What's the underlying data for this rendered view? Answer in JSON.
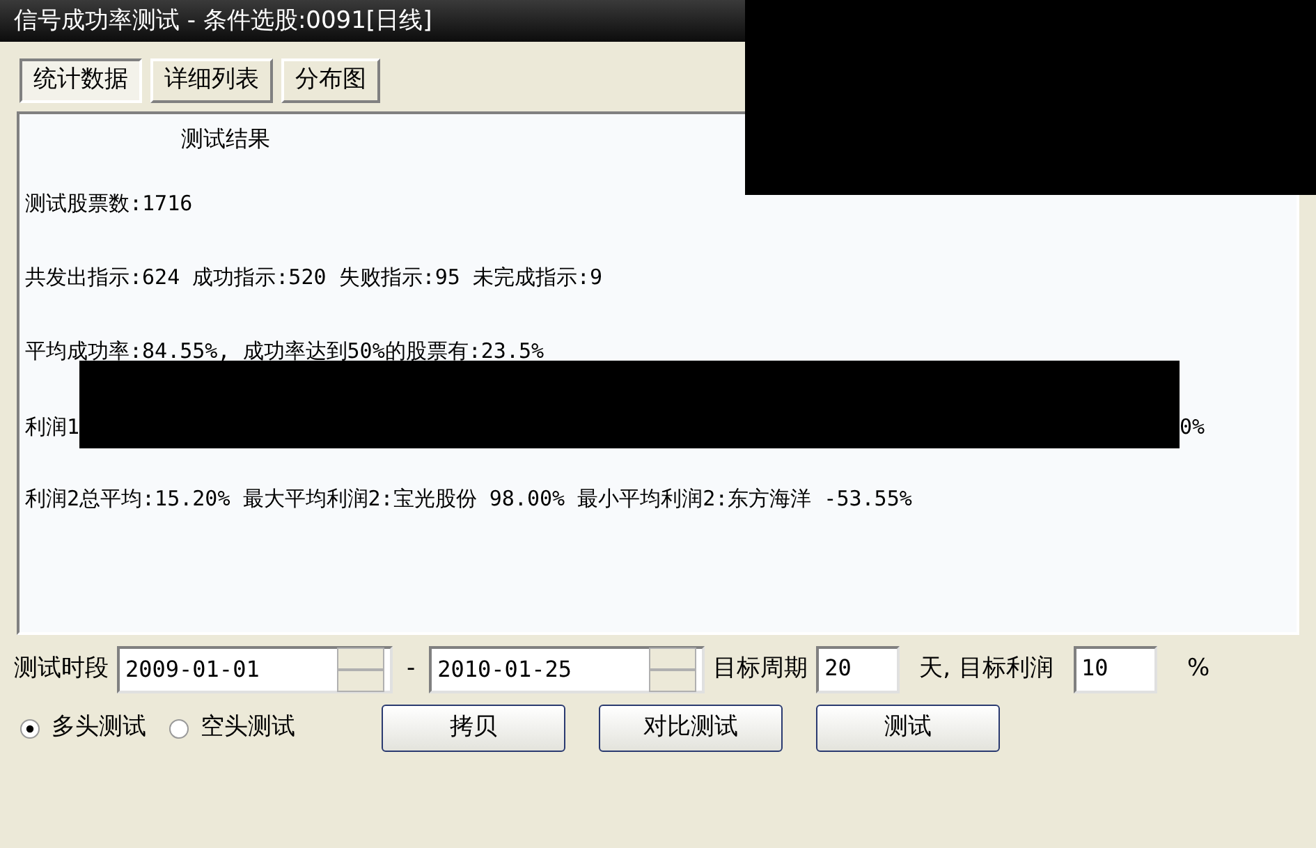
{
  "window": {
    "title": "信号成功率测试 - 条件选股:0091[日线]"
  },
  "tabs": [
    {
      "label": "统计数据",
      "selected": true
    },
    {
      "label": "详细列表",
      "selected": false
    },
    {
      "label": "分布图",
      "selected": false
    }
  ],
  "results": {
    "heading": "测试结果",
    "lines": [
      {
        "kind": "text",
        "text": "测试股票数:1716"
      },
      {
        "kind": "text",
        "text": "共发出指示:624 成功指示:520 失败指示:95 未完成指示:9"
      },
      {
        "kind": "text",
        "text": "平均成功率:84.55%, 成功率达到50%的股票有:23.5%"
      },
      {
        "kind": "redacted",
        "start": "利润1",
        "end": "0%"
      },
      {
        "kind": "text",
        "text": "利润2总平均:15.20% 最大平均利润2:宝光股份 98.00% 最小平均利润2:东方海洋 -53.55%"
      }
    ]
  },
  "period": {
    "label": "测试时段",
    "start": "2009-01-01",
    "separator": "-",
    "end": "2010-01-25"
  },
  "target_period": {
    "label": "目标周期",
    "value": "20",
    "unit": "天,"
  },
  "target_profit": {
    "label": "目标利润",
    "value": "10",
    "unit": "%"
  },
  "modes": [
    {
      "label": "多头测试",
      "selected": true
    },
    {
      "label": "空头测试",
      "selected": false
    }
  ],
  "buttons": [
    "拷贝",
    "对比测试",
    "测试"
  ]
}
